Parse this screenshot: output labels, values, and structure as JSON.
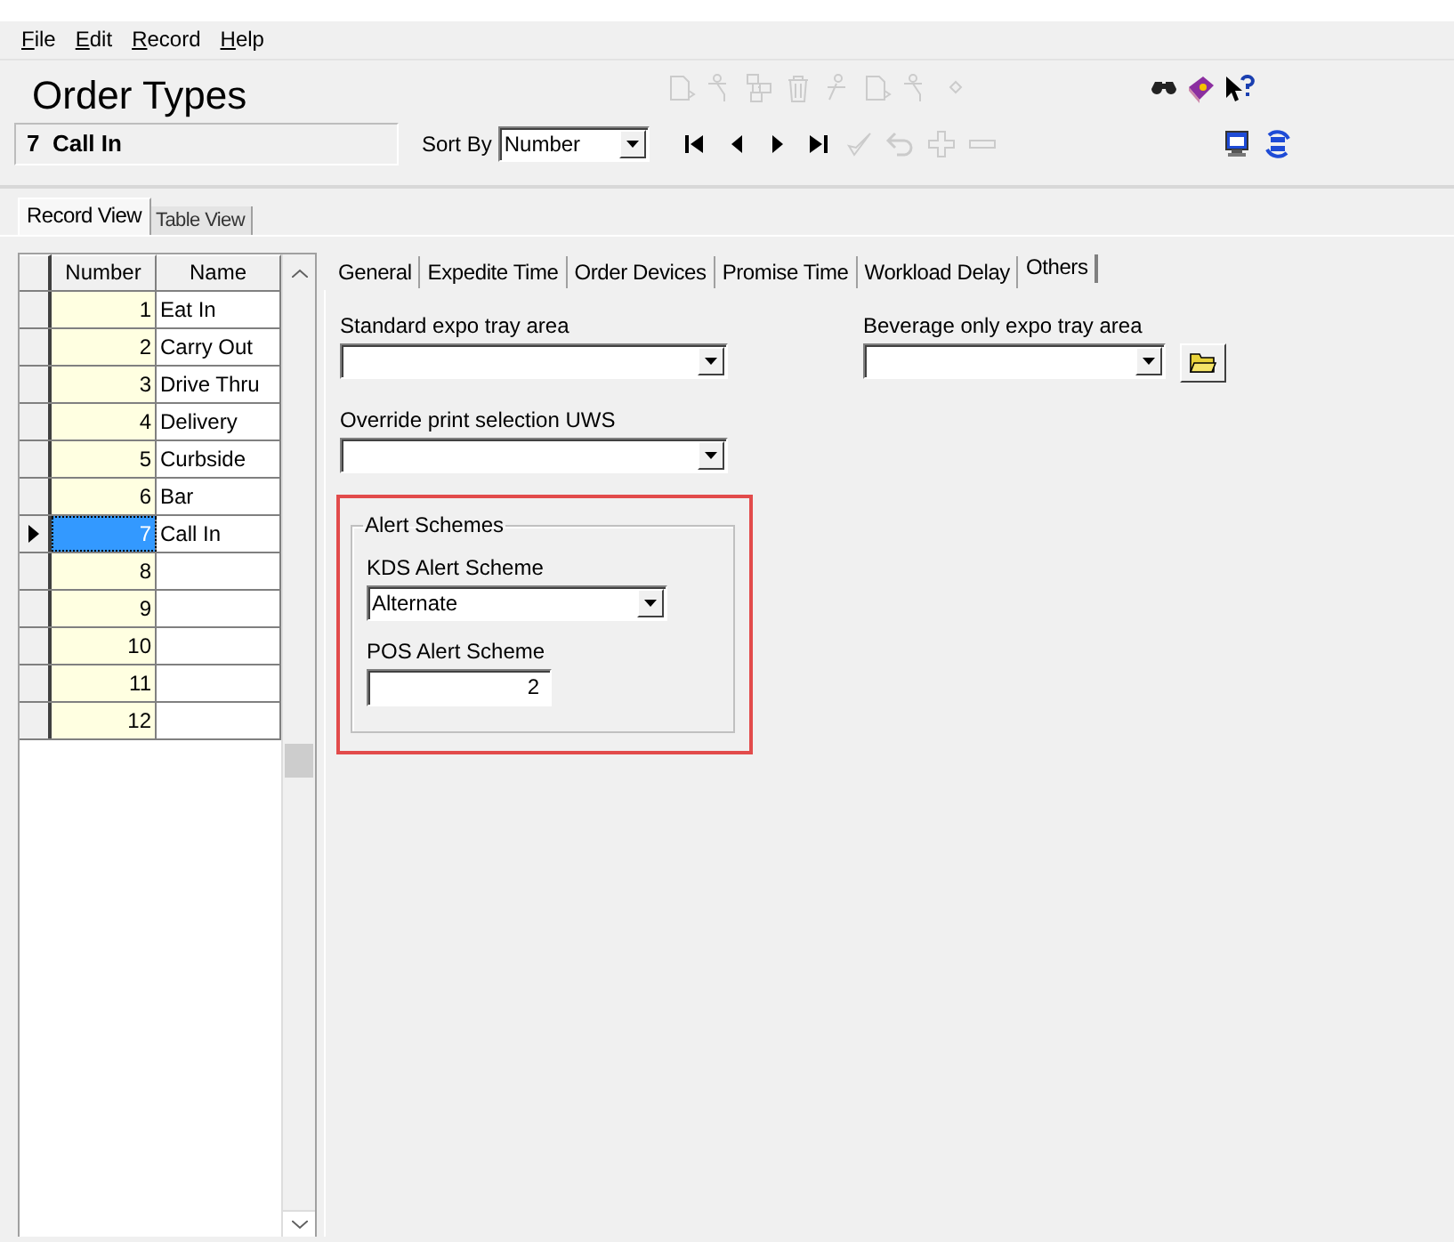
{
  "menu": [
    {
      "label": "File"
    },
    {
      "label": "Edit"
    },
    {
      "label": "Record"
    },
    {
      "label": "Help"
    }
  ],
  "header": {
    "title": "Order Types",
    "record": "7  Call In",
    "sort_label": "Sort By",
    "sort_value": "Number"
  },
  "toolbar_top": [
    {
      "kind": "doc",
      "disabled": true
    },
    {
      "kind": "stairs",
      "disabled": true
    },
    {
      "kind": "tree",
      "disabled": true
    },
    {
      "kind": "trash",
      "disabled": true
    },
    {
      "kind": "person",
      "disabled": true
    },
    {
      "kind": "doc",
      "disabled": true
    },
    {
      "kind": "stairs",
      "disabled": true
    },
    {
      "kind": "diamond",
      "disabled": true
    }
  ],
  "toolbar_top_right": [
    {
      "kind": "binoculars",
      "disabled": false
    },
    {
      "kind": "book",
      "disabled": false
    },
    {
      "kind": "help",
      "disabled": false
    }
  ],
  "toolbar_nav": [
    {
      "kind": "first",
      "disabled": false
    },
    {
      "kind": "prev",
      "disabled": false
    },
    {
      "kind": "next",
      "disabled": false
    },
    {
      "kind": "last",
      "disabled": false
    },
    {
      "kind": "check",
      "disabled": true
    },
    {
      "kind": "undo",
      "disabled": true
    },
    {
      "kind": "plus",
      "disabled": true
    },
    {
      "kind": "minus",
      "disabled": true
    }
  ],
  "toolbar_nav_right": [
    {
      "kind": "monitor",
      "disabled": false
    },
    {
      "kind": "sync",
      "disabled": false
    }
  ],
  "view_tabs": [
    {
      "label": "Record View",
      "selected": true
    },
    {
      "label": "Table View",
      "selected": false
    }
  ],
  "grid": {
    "columns": [
      "Number",
      "Name"
    ],
    "rows": [
      {
        "number": "1",
        "name": "Eat In",
        "selected": false
      },
      {
        "number": "2",
        "name": "Carry Out",
        "selected": false
      },
      {
        "number": "3",
        "name": "Drive Thru",
        "selected": false
      },
      {
        "number": "4",
        "name": "Delivery",
        "selected": false
      },
      {
        "number": "5",
        "name": "Curbside",
        "selected": false
      },
      {
        "number": "6",
        "name": "Bar",
        "selected": false
      },
      {
        "number": "7",
        "name": "Call In",
        "selected": true
      },
      {
        "number": "8",
        "name": "",
        "selected": false
      },
      {
        "number": "9",
        "name": "",
        "selected": false
      },
      {
        "number": "10",
        "name": "",
        "selected": false
      },
      {
        "number": "11",
        "name": "",
        "selected": false
      },
      {
        "number": "12",
        "name": "",
        "selected": false
      }
    ]
  },
  "detail_tabs": [
    {
      "label": "General",
      "selected": false
    },
    {
      "label": "Expedite Time",
      "selected": false
    },
    {
      "label": "Order Devices",
      "selected": false
    },
    {
      "label": "Promise Time",
      "selected": false
    },
    {
      "label": "Workload Delay",
      "selected": false
    },
    {
      "label": "Others",
      "selected": true
    }
  ],
  "others": {
    "standard_expo": {
      "label": "Standard expo tray area"
    },
    "beverage_expo": {
      "label": "Beverage only expo tray area"
    },
    "override_print": {
      "label": "Override print selection UWS"
    },
    "alert_schemes": {
      "title": "Alert Schemes",
      "highlighted": true,
      "kds": {
        "label": "KDS Alert Scheme",
        "value": "Alternate"
      },
      "pos": {
        "label": "POS Alert Scheme",
        "value": "2"
      }
    }
  }
}
